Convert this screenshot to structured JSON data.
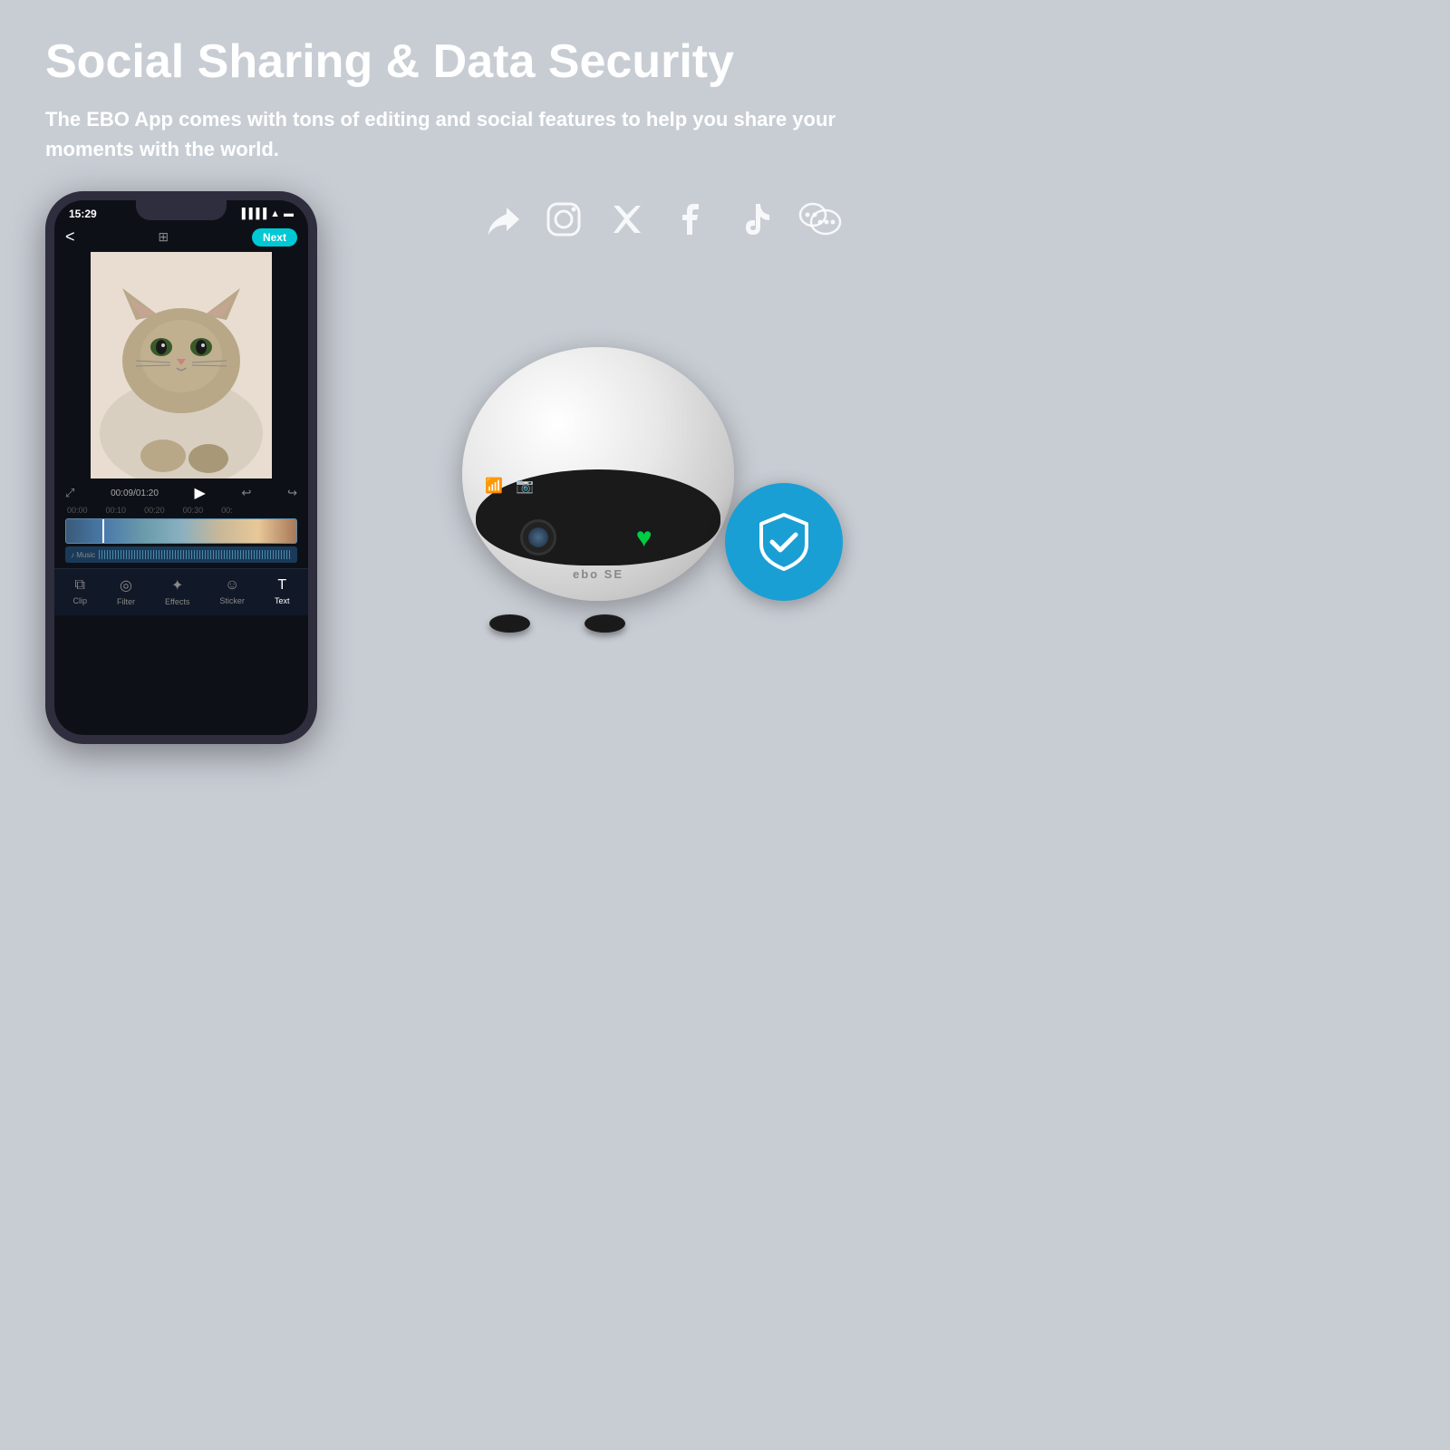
{
  "page": {
    "background_color": "#c8cdd4",
    "title": "Social Sharing & Data Security",
    "subtitle": "The EBO App comes with tons of editing and social features to help you share your moments with the world."
  },
  "phone": {
    "status_time": "15:29",
    "next_button_label": "Next",
    "playback_time": "00:09/01:20",
    "timeline_marks": [
      "00:00",
      "00:10",
      "00:20",
      "00:30",
      "00:"
    ],
    "audio_label": "Music"
  },
  "toolbar": {
    "items": [
      {
        "label": "Clip",
        "icon": "⧉"
      },
      {
        "label": "Filter",
        "icon": "◎"
      },
      {
        "label": "Effects",
        "icon": "✂"
      },
      {
        "label": "Sticker",
        "icon": "☺"
      },
      {
        "label": "Text",
        "icon": "T"
      }
    ]
  },
  "social_icons": [
    {
      "name": "share",
      "symbol": "↪"
    },
    {
      "name": "instagram",
      "symbol": "⊙"
    },
    {
      "name": "twitter",
      "symbol": "𝕏"
    },
    {
      "name": "facebook",
      "symbol": "𝕗"
    },
    {
      "name": "tiktok",
      "symbol": "♪"
    },
    {
      "name": "wechat",
      "symbol": "☯"
    }
  ],
  "robot": {
    "brand_label": "ebo SE",
    "security_badge_visible": true
  }
}
